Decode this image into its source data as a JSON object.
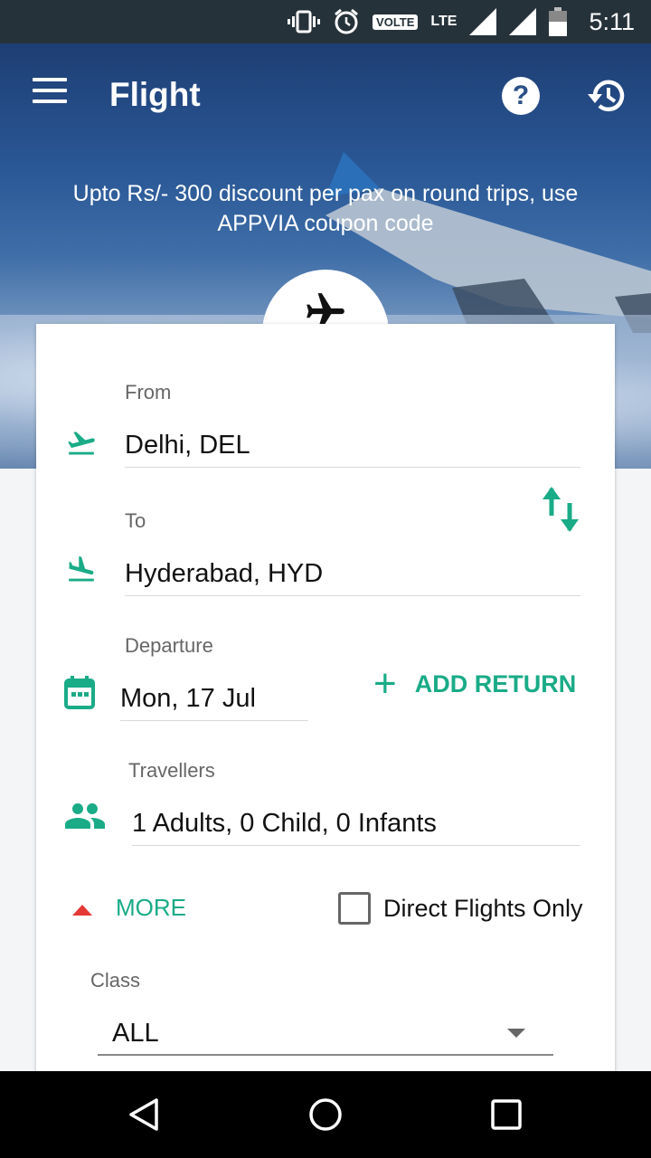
{
  "status_bar": {
    "time": "5:11",
    "volte": "VOLTE",
    "network": "LTE",
    "icons": [
      "vibrate-icon",
      "alarm-icon",
      "signal-icon",
      "signal-icon",
      "battery-icon"
    ]
  },
  "app_bar": {
    "title": "Flight",
    "help_label": "?"
  },
  "promo": {
    "line1": "Upto Rs/- 300 discount per pax on round trips, use",
    "line2": "APPVIA coupon code"
  },
  "form": {
    "from": {
      "label": "From",
      "value": "Delhi, DEL"
    },
    "to": {
      "label": "To",
      "value": "Hyderabad, HYD"
    },
    "departure": {
      "label": "Departure",
      "value": "Mon, 17 Jul"
    },
    "add_return": {
      "plus": "+",
      "label": "ADD RETURN"
    },
    "travellers": {
      "label": "Travellers",
      "value": "1 Adults, 0 Child, 0 Infants"
    },
    "more_label": "MORE",
    "direct_flights_label": "Direct Flights Only",
    "class": {
      "label": "Class",
      "value": "ALL"
    }
  },
  "colors": {
    "accent": "#1aab87",
    "more_arrow": "#e53935",
    "status_bar": "#26323a"
  }
}
